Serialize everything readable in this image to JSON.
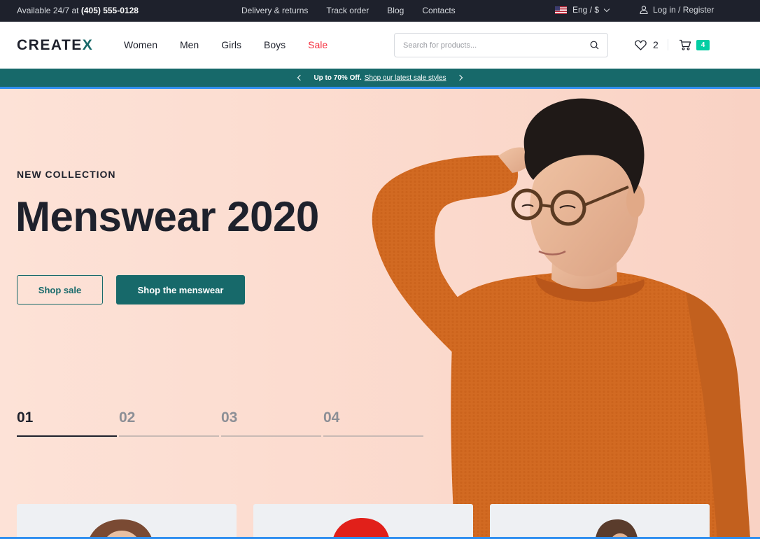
{
  "topbar": {
    "contact_prefix": "Available 24/7 at",
    "phone": "(405) 555-0128",
    "links": [
      "Delivery & returns",
      "Track order",
      "Blog",
      "Contacts"
    ],
    "language": "Eng / $",
    "login": "Log in / Register"
  },
  "header": {
    "logo_main": "CREATE",
    "logo_accent": "X",
    "nav": [
      "Women",
      "Men",
      "Girls",
      "Boys",
      "Sale"
    ],
    "search_placeholder": "Search for products...",
    "wishlist_count": "2",
    "cart_count": "4"
  },
  "promo": {
    "bold": "Up to 70% Off.",
    "link": "Shop our latest sale styles"
  },
  "hero": {
    "eyebrow": "NEW COLLECTION",
    "title": "Menswear 2020",
    "btn_outline": "Shop sale",
    "btn_solid": "Shop the menswear",
    "slides": [
      "01",
      "02",
      "03",
      "04"
    ]
  },
  "colors": {
    "primary": "#17696a",
    "dark": "#1e212c",
    "sale": "#f52f3e",
    "badge": "#03cea4",
    "hero_bg": "#fde1d6",
    "sweater": "#d2691f"
  }
}
